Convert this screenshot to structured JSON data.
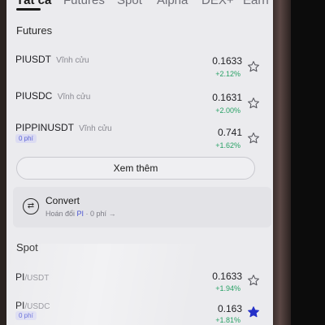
{
  "tabs": [
    {
      "label": "Tất cả",
      "active": true
    },
    {
      "label": "Futures"
    },
    {
      "label": "Spot"
    },
    {
      "label": "Alpha"
    },
    {
      "label": "DEX+"
    },
    {
      "label": "Earn"
    }
  ],
  "futures": {
    "title": "Futures",
    "rows": [
      {
        "symbol": "PIUSDT",
        "suffix": "Vĩnh cửu",
        "price": "0.1633",
        "change": "+2.12%",
        "favorited": false
      },
      {
        "symbol": "PIUSDC",
        "suffix": "Vĩnh cửu",
        "price": "0.1631",
        "change": "+2.00%",
        "favorited": false
      },
      {
        "symbol": "PIPPINUSDT",
        "suffix": "Vĩnh cửu",
        "badge": "0 phí",
        "price": "0.741",
        "change": "+1.62%",
        "favorited": false
      }
    ]
  },
  "see_more": "Xem thêm",
  "convert": {
    "title": "Convert",
    "subtitle_prefix": "Hoán đổi ",
    "subtitle_coin": "PI",
    "subtitle_suffix": " · 0 phí →"
  },
  "spot": {
    "title": "Spot",
    "rows": [
      {
        "base": "PI",
        "quote": "/USDT",
        "price": "0.1633",
        "change": "+1.94%",
        "favorited": false
      },
      {
        "base": "PI",
        "quote": "/USDC",
        "badge": "0 phí",
        "price": "0.163",
        "change": "+1.81%",
        "favorited": true
      }
    ]
  },
  "colors": {
    "positive": "#28a165",
    "accent": "#4a54d0",
    "star_active": "#2530c8"
  }
}
